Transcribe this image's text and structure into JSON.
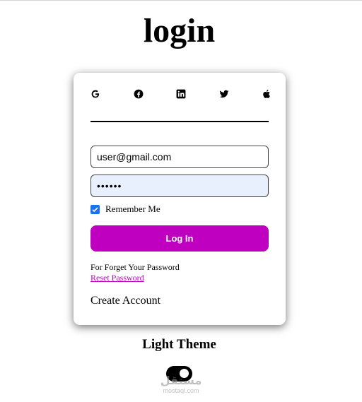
{
  "page": {
    "title": "login"
  },
  "social": {
    "items": [
      {
        "name": "google-icon"
      },
      {
        "name": "facebook-icon"
      },
      {
        "name": "linkedin-icon"
      },
      {
        "name": "twitter-icon"
      },
      {
        "name": "apple-icon"
      }
    ]
  },
  "form": {
    "email_value": "user@gmail.com",
    "password_value": "••••••",
    "remember_label": "Remember Me",
    "remember_checked": true,
    "login_label": "Log In",
    "forgot_text": "For Forget Your Password",
    "reset_link": "Reset Password",
    "create_account": "Create Account"
  },
  "theme": {
    "label": "Light Theme",
    "toggle_on": true
  },
  "watermark": {
    "logo": "مستقل",
    "site": "mostaql.com"
  },
  "colors": {
    "accent": "#c000c0",
    "password_bg": "#e8f0fe",
    "checkbox": "#1a73e8"
  }
}
